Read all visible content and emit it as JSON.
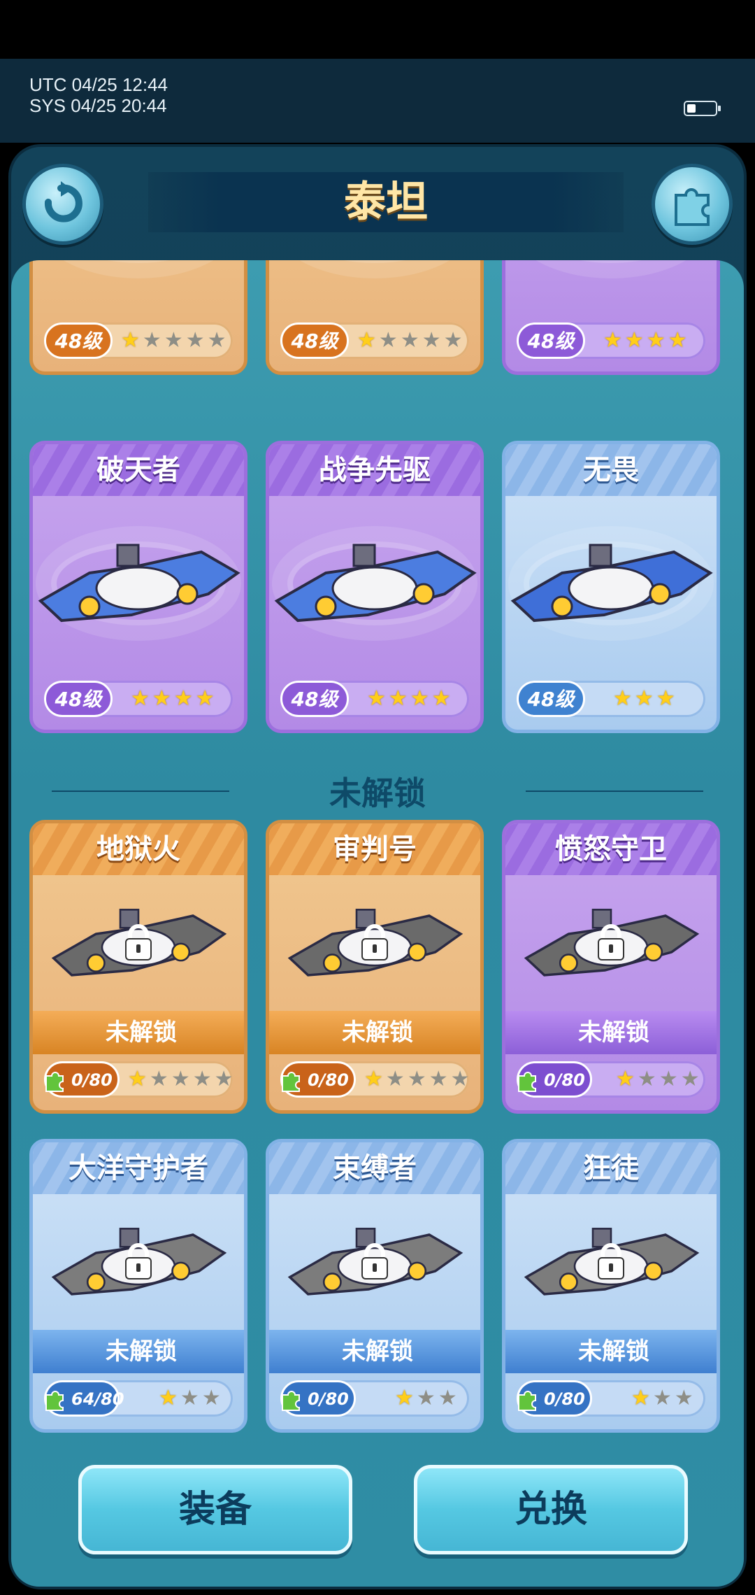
{
  "status": {
    "utc": "UTC 04/25 12:44",
    "sys": "SYS 04/25 20:44"
  },
  "header": {
    "title": "泰坦"
  },
  "owned": [
    {
      "name": "",
      "level": "48级",
      "stars_on": 1,
      "stars_total": 5,
      "rarity": "orange"
    },
    {
      "name": "",
      "level": "48级",
      "stars_on": 1,
      "stars_total": 5,
      "rarity": "orange"
    },
    {
      "name": "",
      "level": "48级",
      "stars_on": 4,
      "stars_total": 4,
      "rarity": "purple"
    },
    {
      "name": "破天者",
      "level": "48级",
      "stars_on": 4,
      "stars_total": 4,
      "rarity": "purple"
    },
    {
      "name": "战争先驱",
      "level": "48级",
      "stars_on": 4,
      "stars_total": 4,
      "rarity": "purple"
    },
    {
      "name": "无畏",
      "level": "48级",
      "stars_on": 3,
      "stars_total": 3,
      "rarity": "blue"
    }
  ],
  "locked_section": {
    "label": "未解锁"
  },
  "locked": [
    {
      "name": "地狱火",
      "status": "未解锁",
      "fragments": "0/80",
      "stars_on": 1,
      "stars_total": 5,
      "rarity": "orange"
    },
    {
      "name": "审判号",
      "status": "未解锁",
      "fragments": "0/80",
      "stars_on": 1,
      "stars_total": 5,
      "rarity": "orange"
    },
    {
      "name": "愤怒守卫",
      "status": "未解锁",
      "fragments": "0/80",
      "stars_on": 1,
      "stars_total": 4,
      "rarity": "purple"
    },
    {
      "name": "大洋守护者",
      "status": "未解锁",
      "fragments": "64/80",
      "stars_on": 1,
      "stars_total": 3,
      "rarity": "blue"
    },
    {
      "name": "束缚者",
      "status": "未解锁",
      "fragments": "0/80",
      "stars_on": 1,
      "stars_total": 3,
      "rarity": "blue"
    },
    {
      "name": "狂徒",
      "status": "未解锁",
      "fragments": "0/80",
      "stars_on": 1,
      "stars_total": 3,
      "rarity": "blue"
    }
  ],
  "buttons": {
    "equip": "装备",
    "exchange": "兑换"
  },
  "icons": {
    "back": "back-arrow-icon",
    "puzzle": "puzzle-icon",
    "lock": "lock-icon",
    "fragment": "puzzle-fragment-icon",
    "star": "star-icon"
  },
  "colors": {
    "orange": "#e8b27a",
    "purple": "#b38ae6",
    "blue": "#a9cbef",
    "accent": "#2f8da4"
  }
}
